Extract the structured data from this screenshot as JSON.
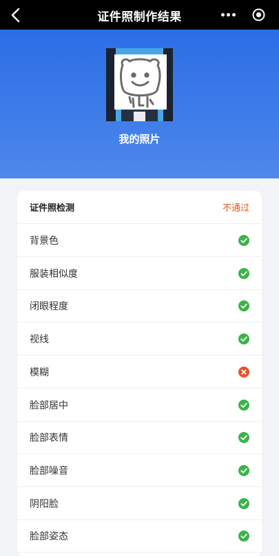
{
  "header": {
    "title": "证件照制作结果",
    "icons": {
      "back": "chevron-left-icon",
      "more": "more-dots-icon",
      "target": "target-icon"
    }
  },
  "hero": {
    "photo_label": "我的照片",
    "background_color": "#2f70e7"
  },
  "check_card": {
    "title": "证件照检测",
    "status": "不通过",
    "status_color": "#e2571e",
    "items": [
      {
        "label": "背景色",
        "result": "pass"
      },
      {
        "label": "服装相似度",
        "result": "pass"
      },
      {
        "label": "闭眼程度",
        "result": "pass"
      },
      {
        "label": "视线",
        "result": "pass"
      },
      {
        "label": "模糊",
        "result": "fail"
      },
      {
        "label": "脸部居中",
        "result": "pass"
      },
      {
        "label": "脸部表情",
        "result": "pass"
      },
      {
        "label": "脸部噪音",
        "result": "pass"
      },
      {
        "label": "阴阳脸",
        "result": "pass"
      },
      {
        "label": "脸部姿态",
        "result": "pass"
      }
    ],
    "pass_color": "#3bb34a",
    "fail_color": "#e6542a"
  }
}
